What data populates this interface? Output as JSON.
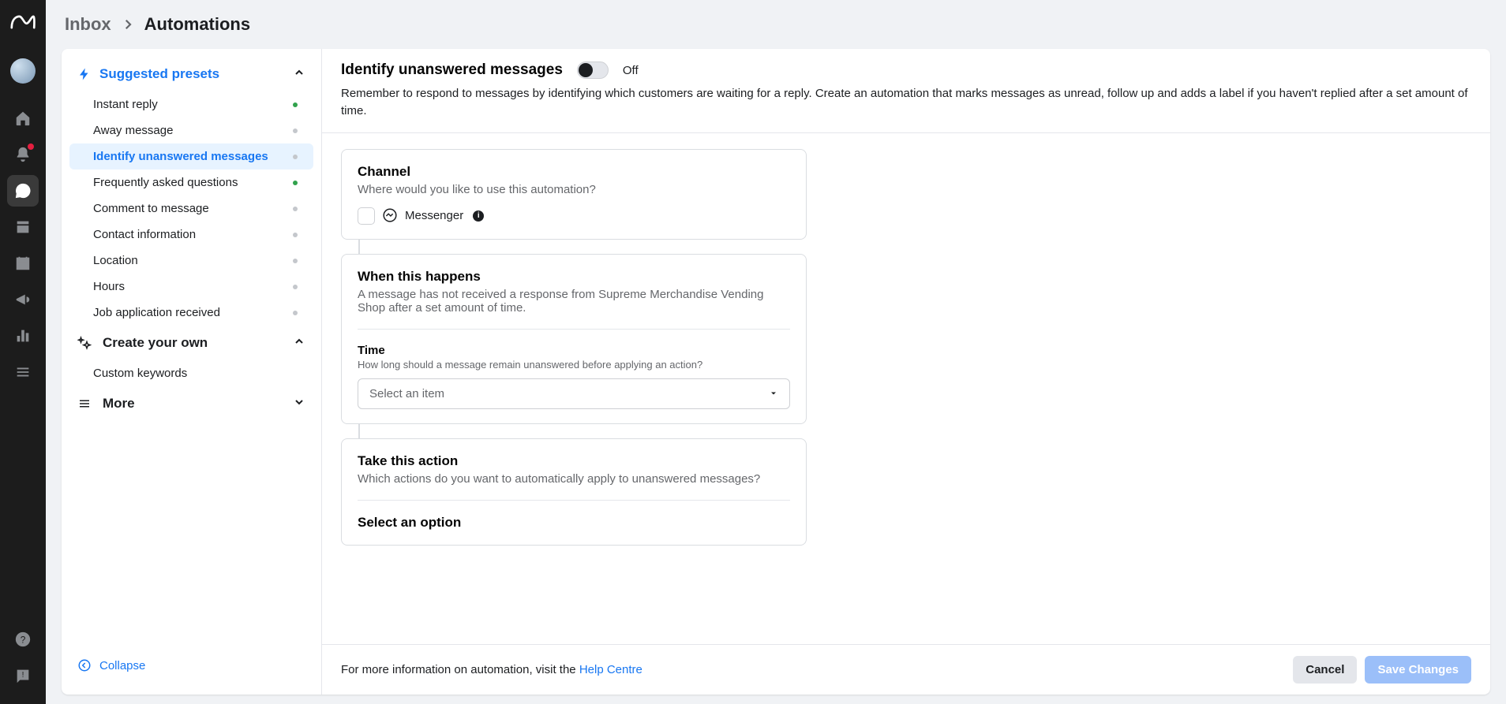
{
  "breadcrumb": {
    "parent": "Inbox",
    "current": "Automations"
  },
  "sidebar": {
    "suggested_label": "Suggested presets",
    "create_label": "Create your own",
    "more_label": "More",
    "collapse_label": "Collapse",
    "presets": [
      {
        "label": "Instant reply",
        "on": true,
        "active": false
      },
      {
        "label": "Away message",
        "on": false,
        "active": false
      },
      {
        "label": "Identify unanswered messages",
        "on": false,
        "active": true
      },
      {
        "label": "Frequently asked questions",
        "on": true,
        "active": false
      },
      {
        "label": "Comment to message",
        "on": false,
        "active": false
      },
      {
        "label": "Contact information",
        "on": false,
        "active": false
      },
      {
        "label": "Location",
        "on": false,
        "active": false
      },
      {
        "label": "Hours",
        "on": false,
        "active": false
      },
      {
        "label": "Job application received",
        "on": false,
        "active": false
      }
    ],
    "custom_items": [
      {
        "label": "Custom keywords"
      }
    ]
  },
  "content": {
    "title": "Identify unanswered messages",
    "toggle_state": "Off",
    "description": "Remember to respond to messages by identifying which customers are waiting for a reply. Create an automation that marks messages as unread, follow up and adds a label if you haven't replied after a set amount of time.",
    "channel": {
      "title": "Channel",
      "subtitle": "Where would you like to use this automation?",
      "option": "Messenger"
    },
    "when": {
      "title": "When this happens",
      "subtitle": "A message has not received a response from Supreme Merchandise Vending Shop after a set amount of time.",
      "time_label": "Time",
      "time_help": "How long should a message remain unanswered before applying an action?",
      "time_placeholder": "Select an item"
    },
    "action": {
      "title": "Take this action",
      "subtitle": "Which actions do you want to automatically apply to unanswered messages?",
      "option_title": "Select an option"
    }
  },
  "footer": {
    "text_prefix": "For more information on automation, visit the ",
    "link_text": "Help Centre",
    "cancel": "Cancel",
    "save": "Save Changes"
  }
}
